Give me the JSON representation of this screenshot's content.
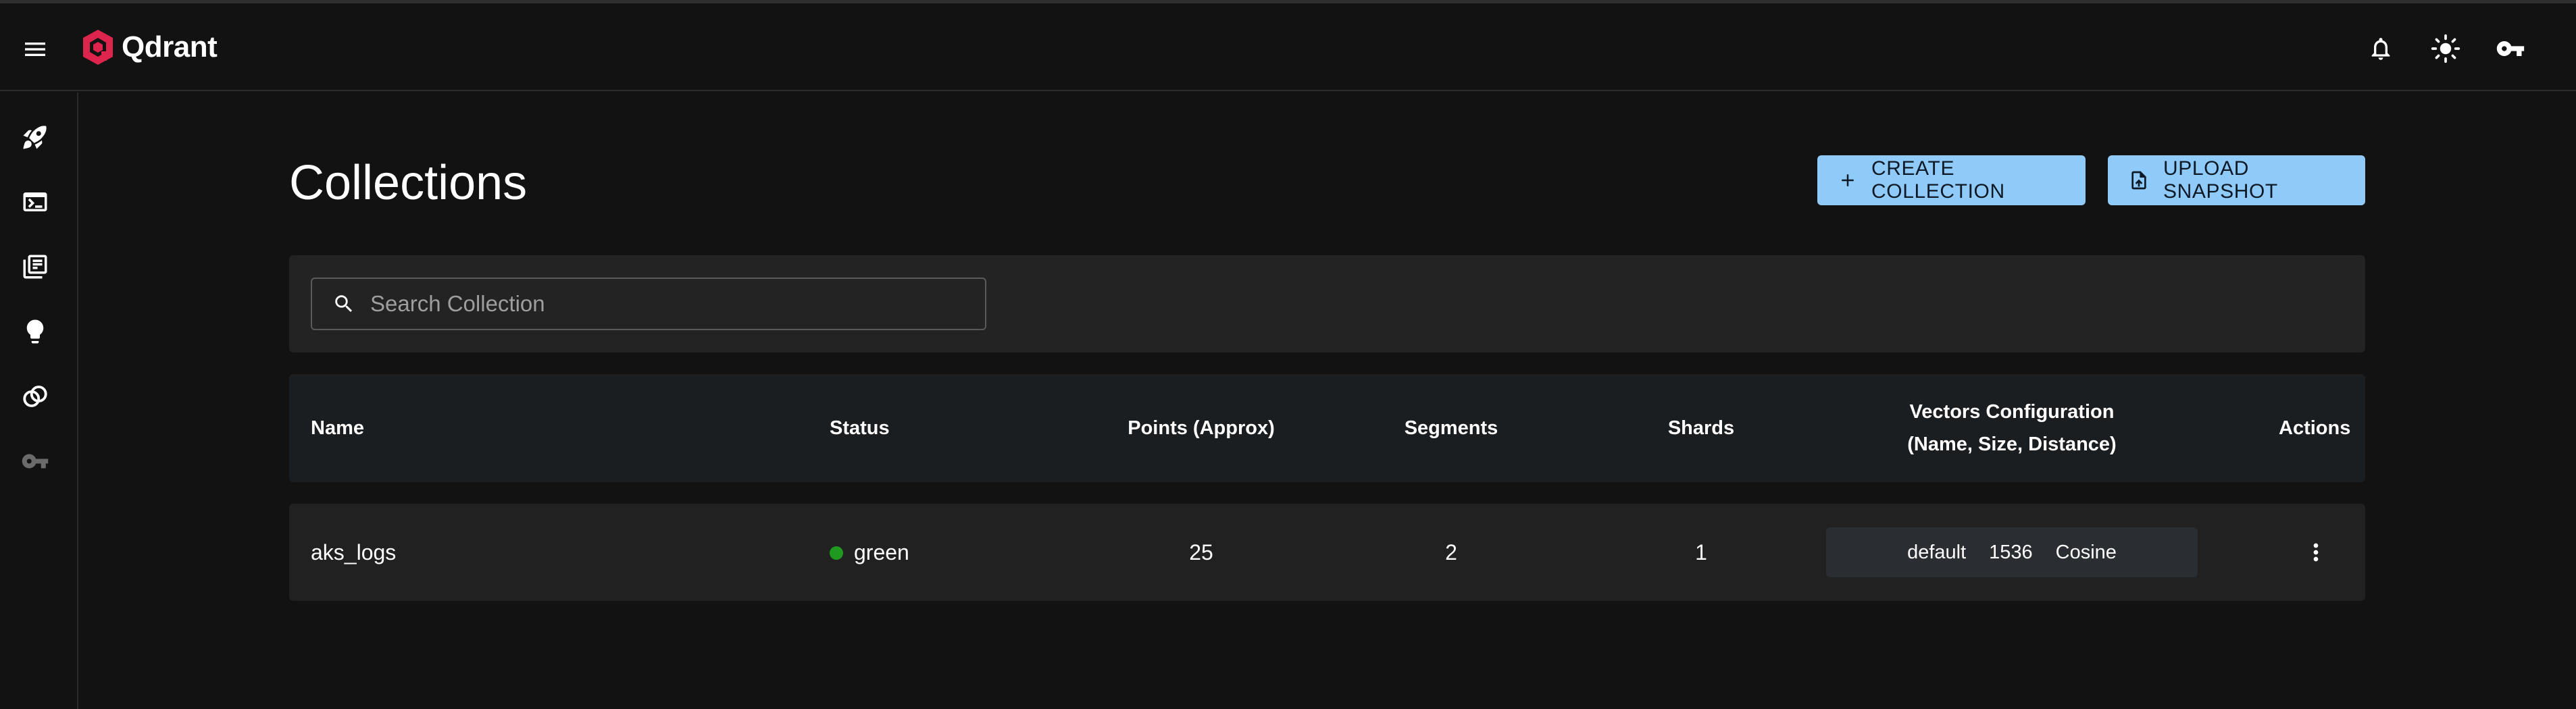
{
  "app": {
    "name": "Qdrant",
    "brand_color": "#dc244c",
    "accent_color": "#90caf9"
  },
  "appbar": {
    "menu_icon": "hamburger-menu-icon",
    "icons": [
      "bell-icon",
      "sun-icon",
      "key-icon"
    ]
  },
  "sidebar": {
    "items": [
      {
        "icon": "rocket-icon"
      },
      {
        "icon": "terminal-icon"
      },
      {
        "icon": "collections-icon"
      },
      {
        "icon": "lightbulb-icon"
      },
      {
        "icon": "rings-icon"
      },
      {
        "icon": "key-icon",
        "disabled": true
      }
    ]
  },
  "page": {
    "title": "Collections",
    "create_button": "CREATE COLLECTION",
    "upload_button": "UPLOAD SNAPSHOT"
  },
  "search": {
    "placeholder": "Search Collection",
    "value": ""
  },
  "table": {
    "headers": {
      "name": "Name",
      "status": "Status",
      "points": "Points (Approx)",
      "segments": "Segments",
      "shards": "Shards",
      "vectors_line1": "Vectors Configuration",
      "vectors_line2": "(Name, Size, Distance)",
      "actions": "Actions"
    },
    "rows": [
      {
        "name": "aks_logs",
        "status": "green",
        "status_color": "#1f9a1f",
        "points": "25",
        "segments": "2",
        "shards": "1",
        "vector_name": "default",
        "vector_size": "1536",
        "vector_distance": "Cosine"
      }
    ]
  }
}
